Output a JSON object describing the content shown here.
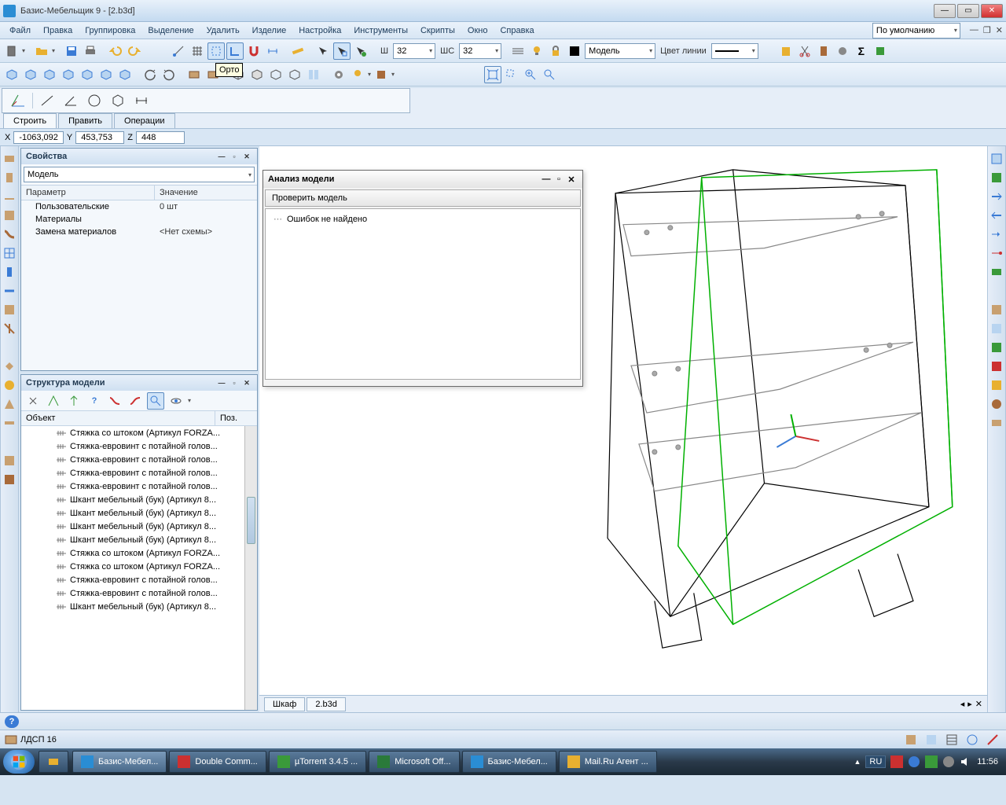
{
  "window": {
    "title": "Базис-Мебельщик 9 - [2.b3d]"
  },
  "menu": {
    "items": [
      "Файл",
      "Правка",
      "Группировка",
      "Выделение",
      "Удалить",
      "Изделие",
      "Настройка",
      "Инструменты",
      "Скрипты",
      "Окно",
      "Справка"
    ],
    "right_label": "По умолчанию"
  },
  "toolbar1": {
    "w_label": "Ш",
    "w_value": "32",
    "ws_label": "ШС",
    "ws_value": "32",
    "model_label": "Модель",
    "linecolor_label": "Цвет линии"
  },
  "tooltip": "Орто",
  "draw_tabs": {
    "tab1": "Строить",
    "tab2": "Править",
    "tab3": "Операции"
  },
  "coords": {
    "xl": "X",
    "xv": "-1063,092",
    "yl": "Y",
    "yv": "453,753",
    "zl": "Z",
    "zv": "448"
  },
  "props": {
    "title": "Свойства",
    "combo": "Модель",
    "col1": "Параметр",
    "col2": "Значение",
    "rows": [
      {
        "p": "Пользовательские",
        "v": "0 шт"
      },
      {
        "p": "Материалы",
        "v": ""
      },
      {
        "p": "Замена материалов",
        "v": "<Нет схемы>"
      }
    ]
  },
  "struct": {
    "title": "Структура модели",
    "col1": "Объект",
    "col2": "Поз.",
    "items": [
      "Стяжка со штоком (Артикул FORZA...",
      "Стяжка-евровинт с потайной голов...",
      "Стяжка-евровинт с потайной голов...",
      "Стяжка-евровинт с потайной голов...",
      "Стяжка-евровинт с потайной голов...",
      "Шкант мебельный (бук) (Артикул 8...",
      "Шкант мебельный (бук) (Артикул 8...",
      "Шкант мебельный (бук) (Артикул 8...",
      "Шкант мебельный (бук) (Артикул 8...",
      "Стяжка со штоком (Артикул FORZA...",
      "Стяжка со штоком (Артикул FORZA...",
      "Стяжка-евровинт с потайной голов...",
      "Стяжка-евровинт с потайной голов...",
      "Шкант мебельный (бук) (Артикул 8..."
    ]
  },
  "analysis": {
    "title": "Анализ модели",
    "button": "Проверить модель",
    "result": "Ошибок не найдено"
  },
  "bottom_tabs": {
    "t1": "Шкаф",
    "t2": "2.b3d"
  },
  "status": {
    "material": "ЛДСП 16"
  },
  "taskbar": {
    "items": [
      "Базис-Мебел...",
      "Double Comm...",
      "µTorrent 3.4.5 ...",
      "Microsoft Off...",
      "Базис-Мебел...",
      "Mail.Ru Агент ..."
    ],
    "lang": "RU",
    "time": "11:56"
  }
}
